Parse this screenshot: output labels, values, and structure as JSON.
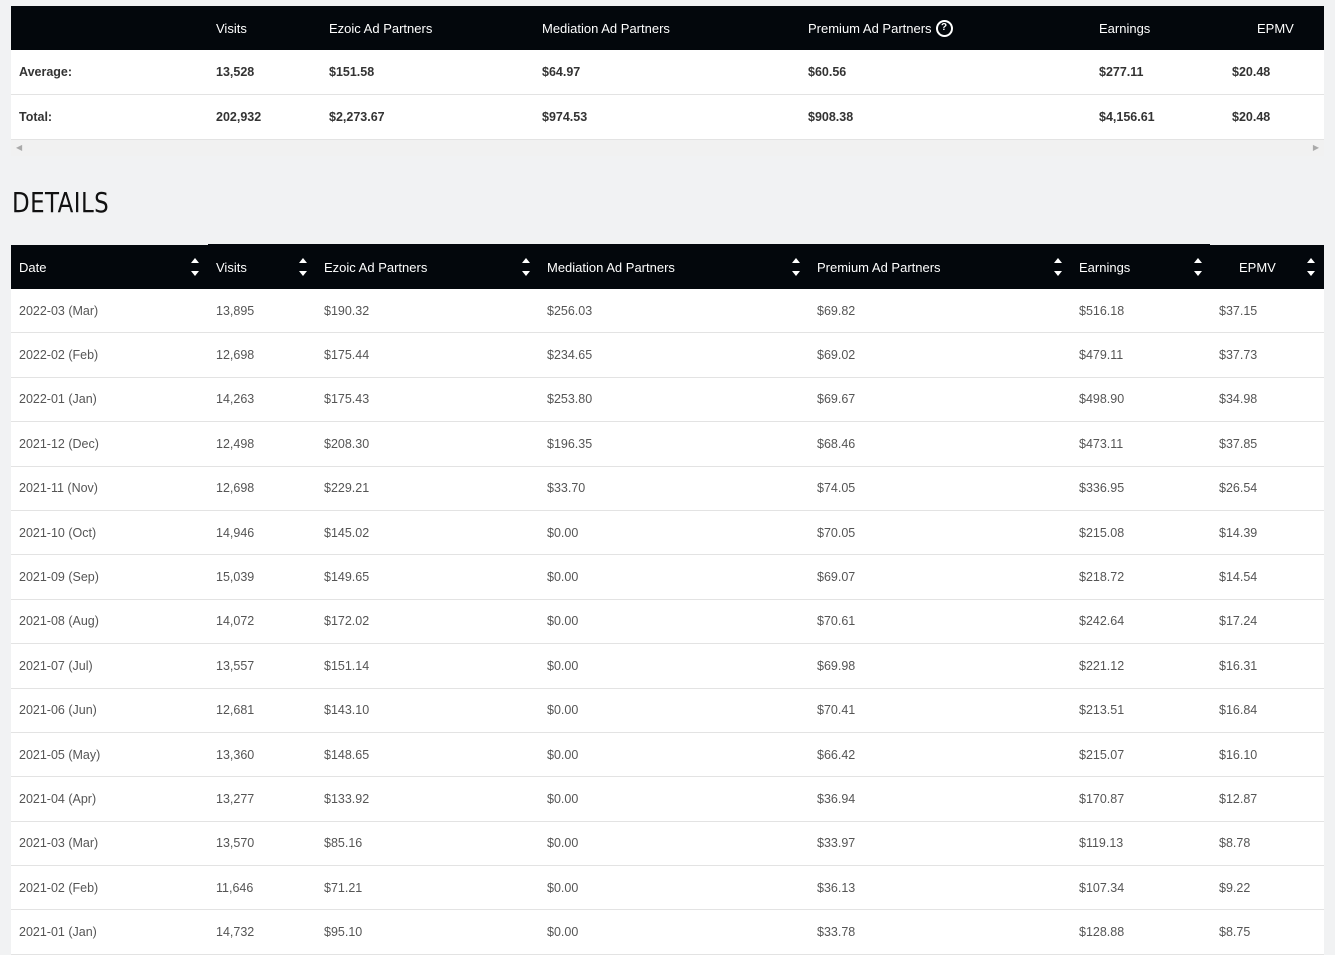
{
  "summary": {
    "headers": [
      "",
      "Visits",
      "Ezoic Ad Partners",
      "Mediation Ad Partners",
      "Premium Ad Partners",
      "Earnings",
      "EPMV"
    ],
    "rows": [
      {
        "label": "Average:",
        "visits": "13,528",
        "ezoic": "$151.58",
        "mediation": "$64.97",
        "premium": "$60.56",
        "earnings": "$277.11",
        "epmv": "$20.48"
      },
      {
        "label": "Total:",
        "visits": "202,932",
        "ezoic": "$2,273.67",
        "mediation": "$974.53",
        "premium": "$908.38",
        "earnings": "$4,156.61",
        "epmv": "$20.48"
      }
    ],
    "help_icon": "question-circle-icon"
  },
  "details": {
    "title": "DETAILS",
    "headers": [
      "Date",
      "Visits",
      "Ezoic Ad Partners",
      "Mediation Ad Partners",
      "Premium Ad Partners",
      "Earnings",
      "EPMV"
    ],
    "rows": [
      [
        "2022-03 (Mar)",
        "13,895",
        "$190.32",
        "$256.03",
        "$69.82",
        "$516.18",
        "$37.15"
      ],
      [
        "2022-02 (Feb)",
        "12,698",
        "$175.44",
        "$234.65",
        "$69.02",
        "$479.11",
        "$37.73"
      ],
      [
        "2022-01 (Jan)",
        "14,263",
        "$175.43",
        "$253.80",
        "$69.67",
        "$498.90",
        "$34.98"
      ],
      [
        "2021-12 (Dec)",
        "12,498",
        "$208.30",
        "$196.35",
        "$68.46",
        "$473.11",
        "$37.85"
      ],
      [
        "2021-11 (Nov)",
        "12,698",
        "$229.21",
        "$33.70",
        "$74.05",
        "$336.95",
        "$26.54"
      ],
      [
        "2021-10 (Oct)",
        "14,946",
        "$145.02",
        "$0.00",
        "$70.05",
        "$215.08",
        "$14.39"
      ],
      [
        "2021-09 (Sep)",
        "15,039",
        "$149.65",
        "$0.00",
        "$69.07",
        "$218.72",
        "$14.54"
      ],
      [
        "2021-08 (Aug)",
        "14,072",
        "$172.02",
        "$0.00",
        "$70.61",
        "$242.64",
        "$17.24"
      ],
      [
        "2021-07 (Jul)",
        "13,557",
        "$151.14",
        "$0.00",
        "$69.98",
        "$221.12",
        "$16.31"
      ],
      [
        "2021-06 (Jun)",
        "12,681",
        "$143.10",
        "$0.00",
        "$70.41",
        "$213.51",
        "$16.84"
      ],
      [
        "2021-05 (May)",
        "13,360",
        "$148.65",
        "$0.00",
        "$66.42",
        "$215.07",
        "$16.10"
      ],
      [
        "2021-04 (Apr)",
        "13,277",
        "$133.92",
        "$0.00",
        "$36.94",
        "$170.87",
        "$12.87"
      ],
      [
        "2021-03 (Mar)",
        "13,570",
        "$85.16",
        "$0.00",
        "$33.97",
        "$119.13",
        "$8.78"
      ],
      [
        "2021-02 (Feb)",
        "11,646",
        "$71.21",
        "$0.00",
        "$36.13",
        "$107.34",
        "$9.22"
      ],
      [
        "2021-01 (Jan)",
        "14,732",
        "$95.10",
        "$0.00",
        "$33.78",
        "$128.88",
        "$8.75"
      ]
    ]
  }
}
